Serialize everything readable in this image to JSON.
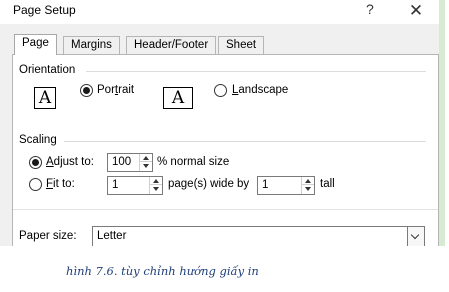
{
  "window": {
    "title": "Page Setup",
    "help_label": "?",
    "close_label": "✕"
  },
  "tabs": [
    {
      "label": "Page",
      "active": true
    },
    {
      "label": "Margins",
      "active": false
    },
    {
      "label": "Header/Footer",
      "active": false
    },
    {
      "label": "Sheet",
      "active": false
    }
  ],
  "orientation": {
    "heading": "Orientation",
    "icon_glyph": "A",
    "portrait": {
      "label": "Portrait",
      "mnemonic": "t",
      "checked": true
    },
    "landscape": {
      "label": "Landscape",
      "mnemonic": "L",
      "checked": false
    }
  },
  "scaling": {
    "heading": "Scaling",
    "adjust_to": {
      "label": "Adjust to:",
      "value": "100",
      "suffix": "% normal size",
      "checked": true
    },
    "fit_to": {
      "label": "Fit to:",
      "wide_value": "1",
      "wide_suffix": "page(s) wide by",
      "tall_value": "1",
      "tall_suffix": "tall",
      "checked": false
    }
  },
  "paper": {
    "label": "Paper size:",
    "value": "Letter"
  },
  "caption": "hình 7.6. tùy chỉnh hướng giấy in",
  "colors": {
    "dialog_bg": "#f0f0f0",
    "panel_bg": "#ffffff",
    "border": "#b5b5b5",
    "caption": "#1f3f7a",
    "side_strip": "#d9ead3"
  }
}
